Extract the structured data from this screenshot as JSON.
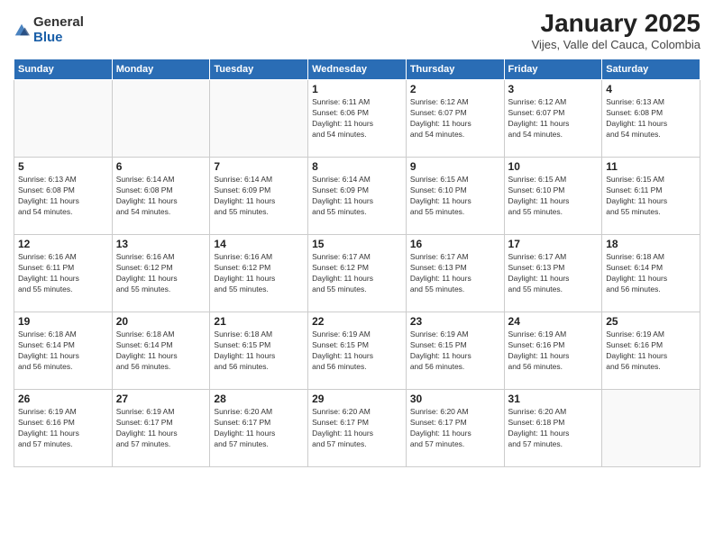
{
  "logo": {
    "general": "General",
    "blue": "Blue"
  },
  "header": {
    "month": "January 2025",
    "location": "Vijes, Valle del Cauca, Colombia"
  },
  "weekdays": [
    "Sunday",
    "Monday",
    "Tuesday",
    "Wednesday",
    "Thursday",
    "Friday",
    "Saturday"
  ],
  "weeks": [
    [
      {
        "day": "",
        "info": ""
      },
      {
        "day": "",
        "info": ""
      },
      {
        "day": "",
        "info": ""
      },
      {
        "day": "1",
        "info": "Sunrise: 6:11 AM\nSunset: 6:06 PM\nDaylight: 11 hours\nand 54 minutes."
      },
      {
        "day": "2",
        "info": "Sunrise: 6:12 AM\nSunset: 6:07 PM\nDaylight: 11 hours\nand 54 minutes."
      },
      {
        "day": "3",
        "info": "Sunrise: 6:12 AM\nSunset: 6:07 PM\nDaylight: 11 hours\nand 54 minutes."
      },
      {
        "day": "4",
        "info": "Sunrise: 6:13 AM\nSunset: 6:08 PM\nDaylight: 11 hours\nand 54 minutes."
      }
    ],
    [
      {
        "day": "5",
        "info": "Sunrise: 6:13 AM\nSunset: 6:08 PM\nDaylight: 11 hours\nand 54 minutes."
      },
      {
        "day": "6",
        "info": "Sunrise: 6:14 AM\nSunset: 6:08 PM\nDaylight: 11 hours\nand 54 minutes."
      },
      {
        "day": "7",
        "info": "Sunrise: 6:14 AM\nSunset: 6:09 PM\nDaylight: 11 hours\nand 55 minutes."
      },
      {
        "day": "8",
        "info": "Sunrise: 6:14 AM\nSunset: 6:09 PM\nDaylight: 11 hours\nand 55 minutes."
      },
      {
        "day": "9",
        "info": "Sunrise: 6:15 AM\nSunset: 6:10 PM\nDaylight: 11 hours\nand 55 minutes."
      },
      {
        "day": "10",
        "info": "Sunrise: 6:15 AM\nSunset: 6:10 PM\nDaylight: 11 hours\nand 55 minutes."
      },
      {
        "day": "11",
        "info": "Sunrise: 6:15 AM\nSunset: 6:11 PM\nDaylight: 11 hours\nand 55 minutes."
      }
    ],
    [
      {
        "day": "12",
        "info": "Sunrise: 6:16 AM\nSunset: 6:11 PM\nDaylight: 11 hours\nand 55 minutes."
      },
      {
        "day": "13",
        "info": "Sunrise: 6:16 AM\nSunset: 6:12 PM\nDaylight: 11 hours\nand 55 minutes."
      },
      {
        "day": "14",
        "info": "Sunrise: 6:16 AM\nSunset: 6:12 PM\nDaylight: 11 hours\nand 55 minutes."
      },
      {
        "day": "15",
        "info": "Sunrise: 6:17 AM\nSunset: 6:12 PM\nDaylight: 11 hours\nand 55 minutes."
      },
      {
        "day": "16",
        "info": "Sunrise: 6:17 AM\nSunset: 6:13 PM\nDaylight: 11 hours\nand 55 minutes."
      },
      {
        "day": "17",
        "info": "Sunrise: 6:17 AM\nSunset: 6:13 PM\nDaylight: 11 hours\nand 55 minutes."
      },
      {
        "day": "18",
        "info": "Sunrise: 6:18 AM\nSunset: 6:14 PM\nDaylight: 11 hours\nand 56 minutes."
      }
    ],
    [
      {
        "day": "19",
        "info": "Sunrise: 6:18 AM\nSunset: 6:14 PM\nDaylight: 11 hours\nand 56 minutes."
      },
      {
        "day": "20",
        "info": "Sunrise: 6:18 AM\nSunset: 6:14 PM\nDaylight: 11 hours\nand 56 minutes."
      },
      {
        "day": "21",
        "info": "Sunrise: 6:18 AM\nSunset: 6:15 PM\nDaylight: 11 hours\nand 56 minutes."
      },
      {
        "day": "22",
        "info": "Sunrise: 6:19 AM\nSunset: 6:15 PM\nDaylight: 11 hours\nand 56 minutes."
      },
      {
        "day": "23",
        "info": "Sunrise: 6:19 AM\nSunset: 6:15 PM\nDaylight: 11 hours\nand 56 minutes."
      },
      {
        "day": "24",
        "info": "Sunrise: 6:19 AM\nSunset: 6:16 PM\nDaylight: 11 hours\nand 56 minutes."
      },
      {
        "day": "25",
        "info": "Sunrise: 6:19 AM\nSunset: 6:16 PM\nDaylight: 11 hours\nand 56 minutes."
      }
    ],
    [
      {
        "day": "26",
        "info": "Sunrise: 6:19 AM\nSunset: 6:16 PM\nDaylight: 11 hours\nand 57 minutes."
      },
      {
        "day": "27",
        "info": "Sunrise: 6:19 AM\nSunset: 6:17 PM\nDaylight: 11 hours\nand 57 minutes."
      },
      {
        "day": "28",
        "info": "Sunrise: 6:20 AM\nSunset: 6:17 PM\nDaylight: 11 hours\nand 57 minutes."
      },
      {
        "day": "29",
        "info": "Sunrise: 6:20 AM\nSunset: 6:17 PM\nDaylight: 11 hours\nand 57 minutes."
      },
      {
        "day": "30",
        "info": "Sunrise: 6:20 AM\nSunset: 6:17 PM\nDaylight: 11 hours\nand 57 minutes."
      },
      {
        "day": "31",
        "info": "Sunrise: 6:20 AM\nSunset: 6:18 PM\nDaylight: 11 hours\nand 57 minutes."
      },
      {
        "day": "",
        "info": ""
      }
    ]
  ]
}
